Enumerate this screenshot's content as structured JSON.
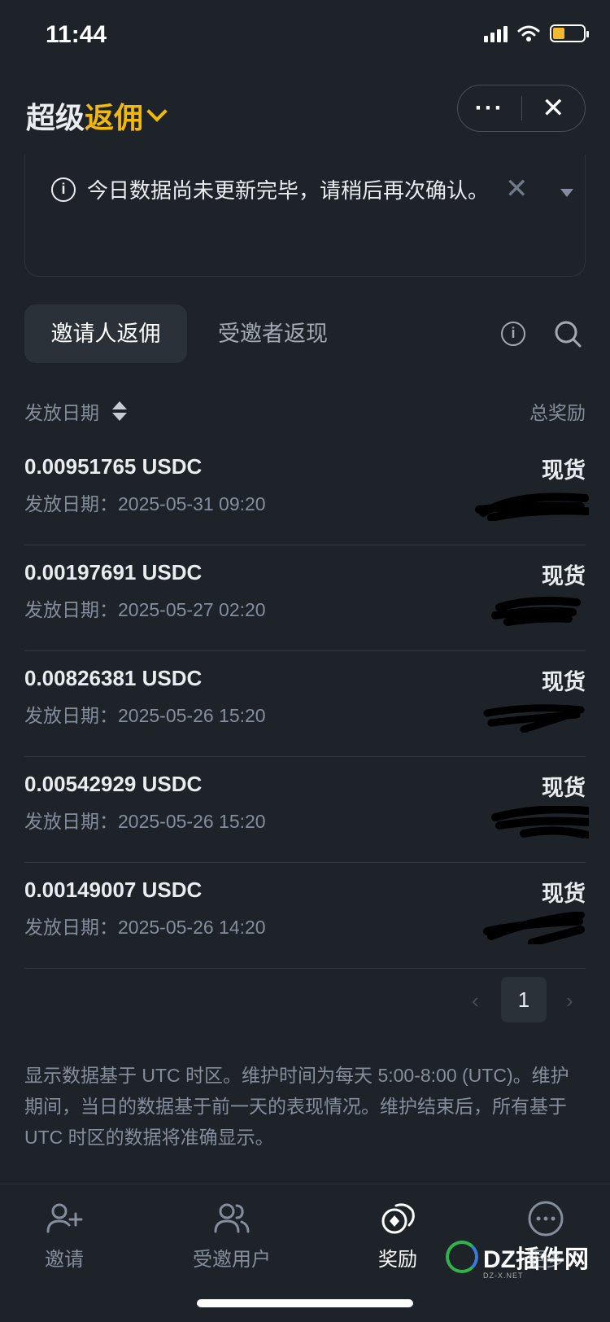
{
  "status_bar": {
    "time": "11:44"
  },
  "header": {
    "title_part1": "超级",
    "title_part2": "返佣",
    "more_label": "···",
    "close_label": "✕"
  },
  "notice": {
    "icon": "info-icon",
    "text": "今日数据尚未更新完毕，请稍后再次确认。",
    "dismiss_label": "✕"
  },
  "tabs": [
    {
      "label": "邀请人返佣",
      "active": true
    },
    {
      "label": "受邀者返现",
      "active": false
    }
  ],
  "list_header": {
    "date_label": "发放日期",
    "total_label": "总奖励"
  },
  "rows": [
    {
      "amount": "0.00951765 USDC",
      "date": "发放日期：2025-05-31 09:20",
      "kind": "现货"
    },
    {
      "amount": "0.00197691 USDC",
      "date": "发放日期：2025-05-27 02:20",
      "kind": "现货"
    },
    {
      "amount": "0.00826381 USDC",
      "date": "发放日期：2025-05-26 15:20",
      "kind": "现货"
    },
    {
      "amount": "0.00542929 USDC",
      "date": "发放日期：2025-05-26 15:20",
      "kind": "现货"
    },
    {
      "amount": "0.00149007 USDC",
      "date": "发放日期：2025-05-26 14:20",
      "kind": "现货"
    }
  ],
  "pagination": {
    "current_page": "1",
    "prev": "‹",
    "next": "›"
  },
  "footnote": "显示数据基于 UTC 时区。维护时间为每天 5:00-8:00 (UTC)。维护期间，当日的数据基于前一天的表现情况。维护结束后，所有基于 UTC 时区的数据将准确显示。",
  "bottom_nav": [
    {
      "label": "邀请",
      "icon": "add-user-icon",
      "active": false
    },
    {
      "label": "受邀用户",
      "icon": "users-icon",
      "active": false
    },
    {
      "label": "奖励",
      "icon": "rewards-icon",
      "active": true
    },
    {
      "label": "更多",
      "icon": "more-icon",
      "active": false
    }
  ],
  "watermark": {
    "text": "DZ插件网",
    "sub": "DZ-X.NET"
  },
  "colors": {
    "background": "#1e2229",
    "accent": "#f0b90b",
    "muted": "#848e9c"
  }
}
